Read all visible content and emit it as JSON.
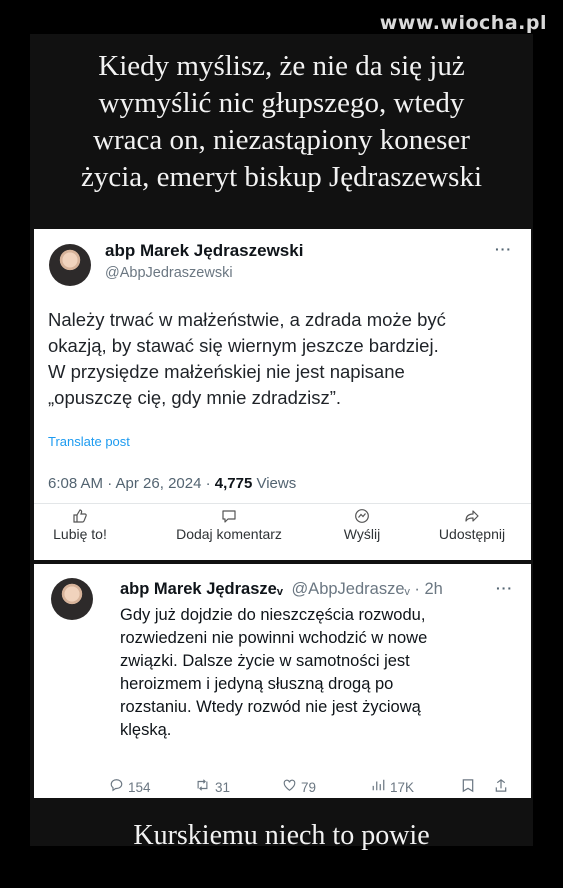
{
  "watermark": "www.wiocha.pl",
  "headline": [
    "Kiedy myślisz, że nie da się już",
    "wymyślić nic głupszego, wtedy",
    "wraca on, niezastąpiony koneser",
    "życia, emeryt biskup Jędraszewski"
  ],
  "post": {
    "name": "abp Marek Jędraszewski",
    "handle": "@AbpJedraszewski",
    "more": "···",
    "text": [
      "Należy trwać w małżeństwie, a zdrada może być",
      "okazją, by stawać się wiernym jeszcze bardziej.",
      "W przysiędze małżeńskiej nie jest napisane",
      "„opuszczę cię, gdy mnie zdradzisz”."
    ],
    "translate": "Translate post",
    "time": "6:08 AM · Apr 26, 2024 · ",
    "views_count": "4,775",
    "views_label": " Views",
    "actions": {
      "like": "Lubię to!",
      "comment": "Dodaj komentarz",
      "send": "Wyślij",
      "share": "Udostępnij"
    }
  },
  "reply": {
    "name": "abp Marek Jędraszeᵥ",
    "handle": "@AbpJedraszeᵥ · 2h",
    "more": "···",
    "text": [
      "Gdy już dojdzie do nieszczęścia rozwodu,",
      "rozwiedzeni nie powinni wchodzić w nowe",
      "związki. Dalsze życie w samotności jest",
      "heroizmem i jedyną słuszną drogą po",
      "rozstaniu. Wtedy rozwód nie jest życiową",
      "klęską."
    ],
    "stats": {
      "replies": "154",
      "reposts": "31",
      "likes": "79",
      "views": "17K"
    }
  },
  "footer": "Kurskiemu niech to powie",
  "colors": {
    "background": "#000000",
    "card": "#ffffff",
    "link": "#1d9bf0",
    "muted": "#536471"
  },
  "icons": [
    "like-icon",
    "comment-icon",
    "send-icon",
    "share-icon",
    "reply-icon",
    "repost-icon",
    "heart-icon",
    "views-icon",
    "bookmark-icon",
    "upload-icon"
  ]
}
